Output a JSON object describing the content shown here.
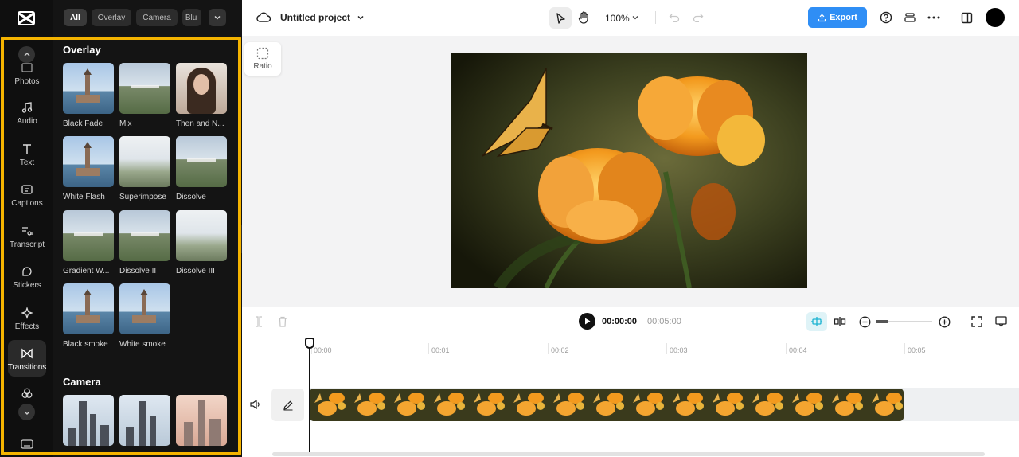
{
  "brand": {
    "accent": "#2f8ef5",
    "highlight": "#f5b400",
    "rail_bg": "#0f0f0f",
    "panel_bg": "#141414"
  },
  "filter_chips": [
    "All",
    "Overlay",
    "Camera",
    "Blu"
  ],
  "rail": {
    "items": [
      {
        "label": "Photos",
        "icon": "photos-icon"
      },
      {
        "label": "Audio",
        "icon": "music-note-icon"
      },
      {
        "label": "Text",
        "icon": "text-icon"
      },
      {
        "label": "Captions",
        "icon": "captions-icon"
      },
      {
        "label": "Transcript",
        "icon": "transcript-icon"
      },
      {
        "label": "Stickers",
        "icon": "sticker-icon"
      },
      {
        "label": "Effects",
        "icon": "sparkle-icon"
      },
      {
        "label": "Transitions",
        "icon": "bowtie-icon",
        "active": true
      }
    ]
  },
  "panel": {
    "overlay_title": "Overlay",
    "overlay_items": [
      "Black Fade",
      "Mix",
      "Then and N...",
      "White Flash",
      "Superimpose",
      "Dissolve",
      "Gradient W...",
      "Dissolve II",
      "Dissolve III",
      "Black smoke",
      "White smoke"
    ],
    "camera_title": "Camera"
  },
  "topbar": {
    "project_name": "Untitled project",
    "zoom": "100%",
    "export_label": "Export"
  },
  "stage": {
    "ratio_label": "Ratio"
  },
  "timeline": {
    "current_time": "00:00:00",
    "separator": "|",
    "total_time": "00:05:00",
    "ruler": [
      "00:00",
      "00:01",
      "00:02",
      "00:03",
      "00:04",
      "00:05"
    ],
    "zoom_level": 0.2
  }
}
